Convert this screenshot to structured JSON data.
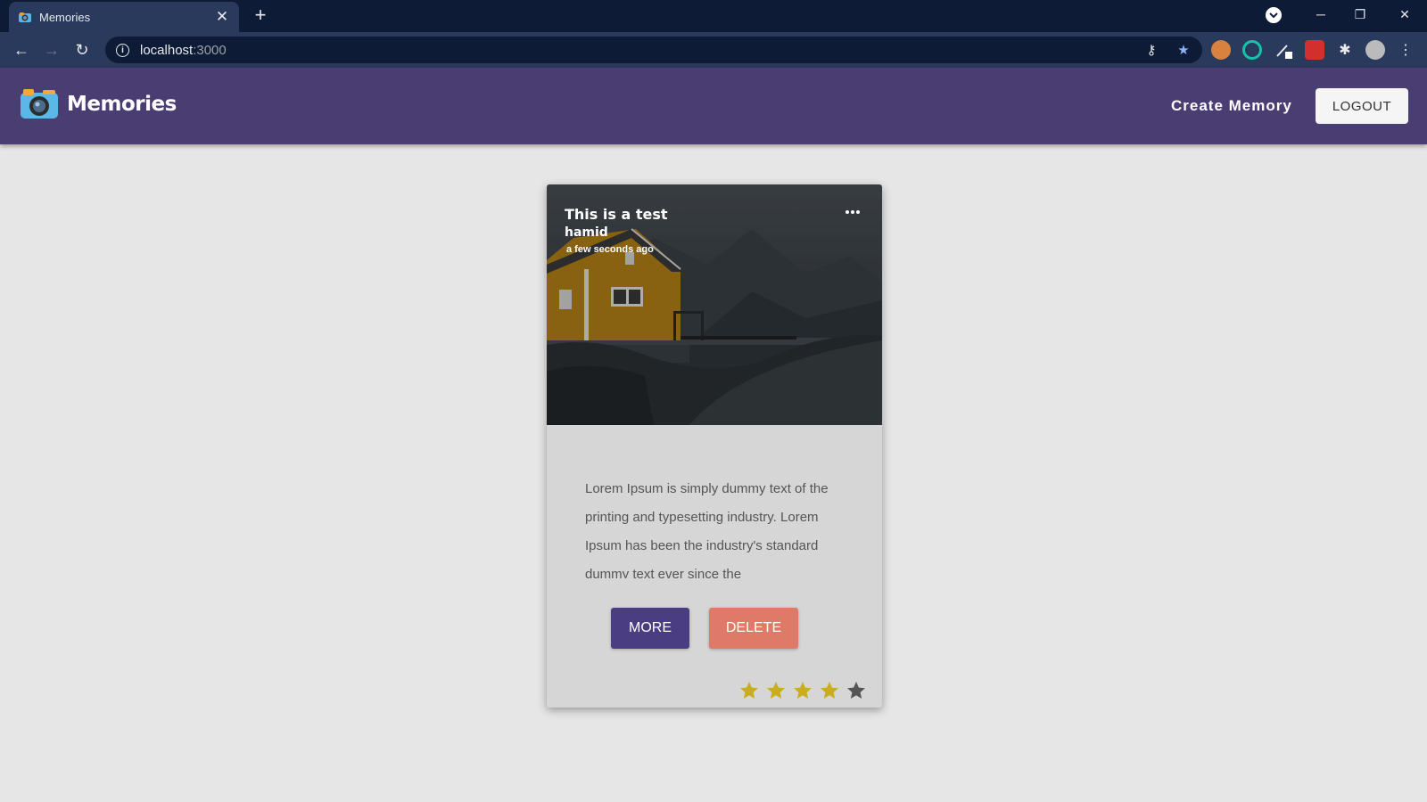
{
  "browser": {
    "tab_title": "Memories",
    "url_host": "localhost",
    "url_port": ":3000"
  },
  "app": {
    "logo_text": "Memories",
    "create_link": "Create Memory",
    "logout_label": "LOGOUT"
  },
  "card": {
    "title": "This is a test",
    "author": "hamid",
    "time": "a few seconds ago",
    "description": "Lorem Ipsum is simply dummy text of the printing and typesetting industry. Lorem Ipsum has been the industry's standard dummy text ever since the",
    "more_label": "MORE",
    "delete_label": "DELETE",
    "rating": {
      "value": 4,
      "max": 5
    }
  },
  "colors": {
    "header": "#4a3d72",
    "more_button": "#4a3d82",
    "delete_button": "#e07a68",
    "star_filled": "#c9ad1d",
    "star_empty": "#555555"
  }
}
